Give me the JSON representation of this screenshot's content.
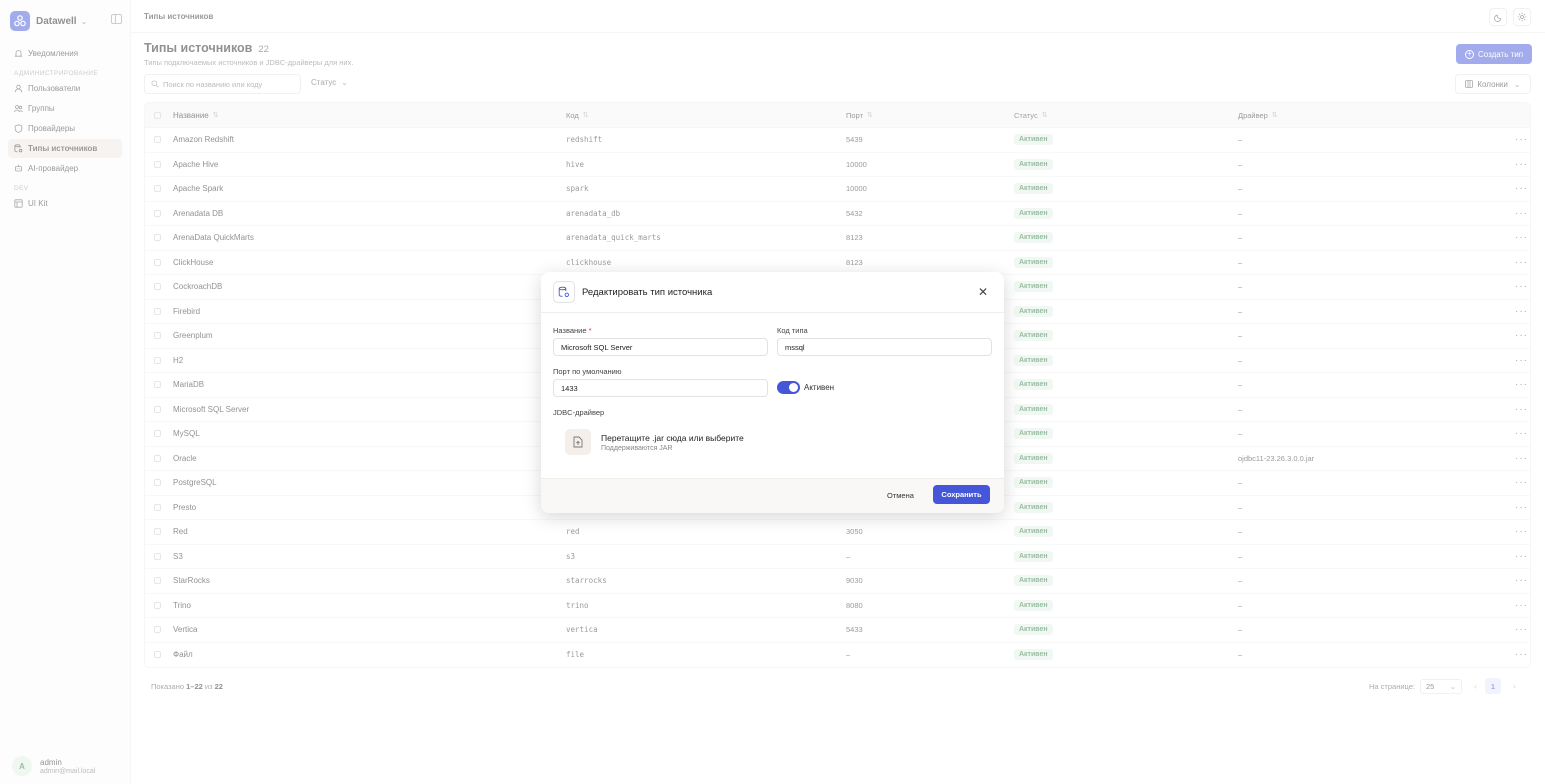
{
  "app": {
    "name": "Datawell",
    "brand_color": "#4556d8"
  },
  "sidebar": {
    "top_item": {
      "label": "Уведомления",
      "icon": "bell-icon"
    },
    "section_admin": "Администрирование",
    "admin_items": [
      {
        "label": "Пользователи",
        "icon": "user-icon"
      },
      {
        "label": "Группы",
        "icon": "group-icon"
      },
      {
        "label": "Провайдеры",
        "icon": "shield-icon"
      },
      {
        "label": "Типы источников",
        "icon": "database-gear-icon",
        "active": true
      },
      {
        "label": "AI-провайдер",
        "icon": "robot-icon"
      }
    ],
    "section_dev": "DEV",
    "dev_items": [
      {
        "label": "UI Kit",
        "icon": "ui-kit-icon"
      }
    ],
    "user": {
      "initial": "A",
      "name": "admin",
      "email": "admin@mail.local"
    }
  },
  "topbar": {
    "breadcrumb": "Типы источников"
  },
  "page": {
    "title": "Типы источников",
    "count": "22",
    "subtitle": "Типы подключаемых источников и JDBC-драйверы для них.",
    "create_label": "Создать тип",
    "search_placeholder": "Поиск по названию или коду",
    "status_filter_label": "Статус",
    "columns_label": "Колонки"
  },
  "table": {
    "headers": {
      "name": "Название",
      "code": "Код",
      "port": "Порт",
      "status": "Статус",
      "driver": "Драйвер"
    },
    "rows": [
      {
        "name": "Amazon Redshift",
        "code": "redshift",
        "port": "5439",
        "status": "Активен",
        "driver": "–"
      },
      {
        "name": "Apache Hive",
        "code": "hive",
        "port": "10000",
        "status": "Активен",
        "driver": "–"
      },
      {
        "name": "Apache Spark",
        "code": "spark",
        "port": "10000",
        "status": "Активен",
        "driver": "–"
      },
      {
        "name": "Arenadata DB",
        "code": "arenadata_db",
        "port": "5432",
        "status": "Активен",
        "driver": "–"
      },
      {
        "name": "ArenaData QuickMarts",
        "code": "arenadata_quick_marts",
        "port": "8123",
        "status": "Активен",
        "driver": "–"
      },
      {
        "name": "ClickHouse",
        "code": "clickhouse",
        "port": "8123",
        "status": "Активен",
        "driver": "–"
      },
      {
        "name": "CockroachDB",
        "code": "",
        "port": "",
        "status": "Активен",
        "driver": "–"
      },
      {
        "name": "Firebird",
        "code": "",
        "port": "",
        "status": "Активен",
        "driver": "–"
      },
      {
        "name": "Greenplum",
        "code": "",
        "port": "",
        "status": "Активен",
        "driver": "–"
      },
      {
        "name": "H2",
        "code": "",
        "port": "",
        "status": "Активен",
        "driver": "–"
      },
      {
        "name": "MariaDB",
        "code": "",
        "port": "",
        "status": "Активен",
        "driver": "–"
      },
      {
        "name": "Microsoft SQL Server",
        "code": "",
        "port": "",
        "status": "Активен",
        "driver": "–"
      },
      {
        "name": "MySQL",
        "code": "",
        "port": "",
        "status": "Активен",
        "driver": "–"
      },
      {
        "name": "Oracle",
        "code": "",
        "port": "",
        "status": "Активен",
        "driver": "ojdbc11-23.26.3.0.0.jar"
      },
      {
        "name": "PostgreSQL",
        "code": "",
        "port": "",
        "status": "Активен",
        "driver": "–"
      },
      {
        "name": "Presto",
        "code": "",
        "port": "",
        "status": "Активен",
        "driver": "–"
      },
      {
        "name": "Red",
        "code": "red",
        "port": "3050",
        "status": "Активен",
        "driver": "–"
      },
      {
        "name": "S3",
        "code": "s3",
        "port": "–",
        "status": "Активен",
        "driver": "–"
      },
      {
        "name": "StarRocks",
        "code": "starrocks",
        "port": "9030",
        "status": "Активен",
        "driver": "–"
      },
      {
        "name": "Trino",
        "code": "trino",
        "port": "8080",
        "status": "Активен",
        "driver": "–"
      },
      {
        "name": "Vertica",
        "code": "vertica",
        "port": "5433",
        "status": "Активен",
        "driver": "–"
      },
      {
        "name": "Файл",
        "code": "file",
        "port": "–",
        "status": "Активен",
        "driver": "–"
      }
    ]
  },
  "footer": {
    "shown_prefix": "Показано",
    "shown_range": "1–22",
    "shown_of": "из",
    "shown_total": "22",
    "per_page_label": "На странице:",
    "per_page_value": "25",
    "current_page": "1"
  },
  "modal": {
    "title": "Редактировать тип источника",
    "name_label": "Название",
    "name_required": "*",
    "name_value": "Microsoft SQL Server",
    "code_label": "Код типа",
    "code_value": "mssql",
    "port_label": "Порт по умолчанию",
    "port_value": "1433",
    "active_label": "Активен",
    "active": true,
    "driver_label": "JDBC-драйвер",
    "drop_title": "Перетащите .jar сюда или выберите",
    "drop_sub": "Поддерживаются JAR",
    "cancel_label": "Отмена",
    "save_label": "Сохранить"
  }
}
